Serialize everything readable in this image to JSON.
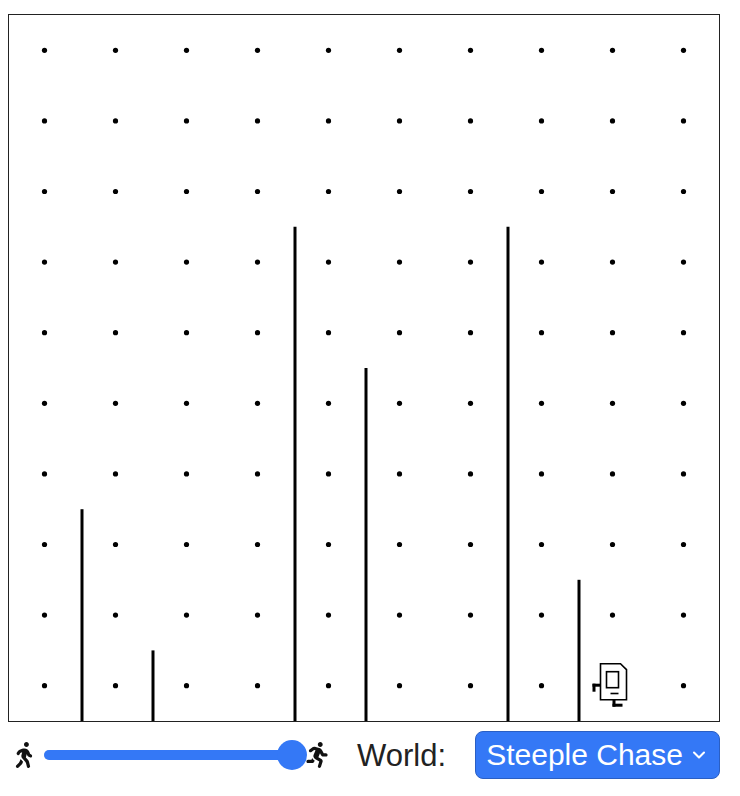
{
  "world": {
    "label": "World:",
    "name": "Steeple Chase",
    "columns": 10,
    "rows": 10
  },
  "robot": {
    "column": 8,
    "row": 0,
    "facing": "east"
  },
  "walls": [
    {
      "after_column": 0,
      "height": 3
    },
    {
      "after_column": 1,
      "height": 1
    },
    {
      "after_column": 3,
      "height": 7
    },
    {
      "after_column": 4,
      "height": 5
    },
    {
      "after_column": 6,
      "height": 7
    },
    {
      "after_column": 7,
      "height": 2
    }
  ],
  "speed": {
    "level": 1
  }
}
